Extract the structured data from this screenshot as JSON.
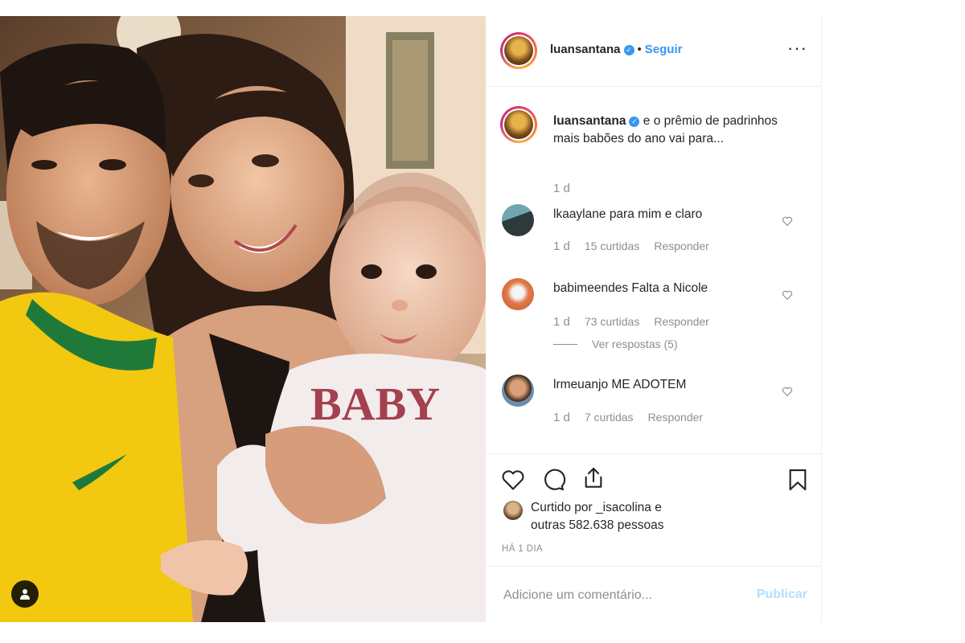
{
  "post": {
    "author": "luansantana",
    "follow_label": "Seguir",
    "separator": "•",
    "more_label": "···",
    "caption_text": "e o prêmio de padrinhos mais babões do ano vai para...",
    "caption_time": "1 d",
    "photo_text": "BABY"
  },
  "comments": [
    {
      "username": "lkaaylane",
      "text": "para mim e claro",
      "time": "1 d",
      "likes": "15 curtidas",
      "reply_label": "Responder"
    },
    {
      "username": "babimeendes",
      "text": "Falta a Nicole",
      "time": "1 d",
      "likes": "73 curtidas",
      "reply_label": "Responder",
      "view_replies": "Ver respostas (5)"
    },
    {
      "username": "lrmeuanjo",
      "text": "ME ADOTEM",
      "time": "1 d",
      "likes": "7 curtidas",
      "reply_label": "Responder"
    }
  ],
  "likes": {
    "line1": "Curtido por _isacolina e",
    "line2": "outras 582.638 pessoas"
  },
  "timestamp": "HÁ 1 DIA",
  "add_comment": {
    "placeholder": "Adicione um comentário...",
    "publish_label": "Publicar"
  },
  "colors": {
    "accent": "#3897f0",
    "publish_disabled": "#b2dffc",
    "muted": "#8e8e8e",
    "jersey_yellow": "#f2c811",
    "jersey_green": "#1f7a3a"
  },
  "icons": [
    "verified-badge-icon",
    "more-options-icon",
    "heart-icon",
    "comment-icon",
    "share-icon",
    "bookmark-icon",
    "user-tag-icon"
  ]
}
